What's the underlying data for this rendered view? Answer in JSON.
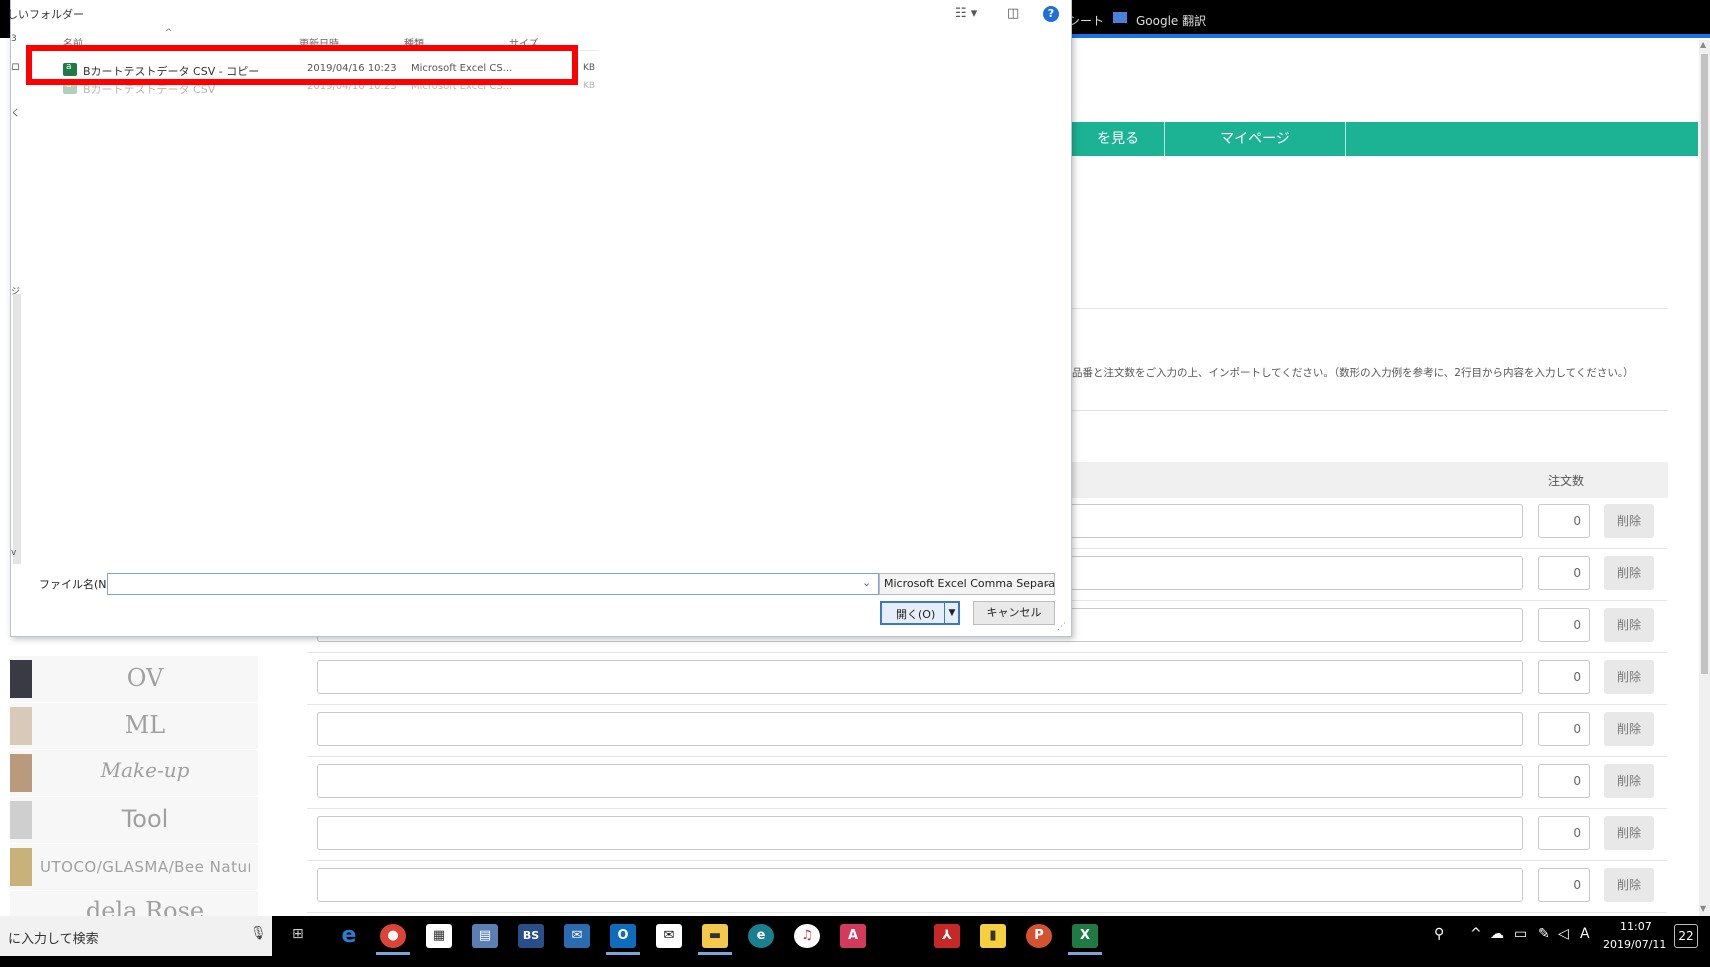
{
  "browser": {
    "bookmarks": [
      {
        "label": "シート"
      },
      {
        "label": "Google 翻訳"
      }
    ],
    "nav": [
      {
        "label": "を見る"
      },
      {
        "label": "マイページ"
      }
    ],
    "instruction": "品番と注文数をご入力の上、インポートしてください。（数形の入力例を参考に、2行目から内容を入力してください。）",
    "qty_header": "注文数",
    "rows": [
      {
        "qty": "0",
        "delete": "削除"
      },
      {
        "qty": "0",
        "delete": "削除"
      },
      {
        "qty": "0",
        "delete": "削除"
      },
      {
        "qty": "0",
        "delete": "削除"
      },
      {
        "qty": "0",
        "delete": "削除"
      },
      {
        "qty": "0",
        "delete": "削除"
      },
      {
        "qty": "0",
        "delete": "削除"
      },
      {
        "qty": "0",
        "delete": "削除"
      }
    ],
    "brands": [
      {
        "name": "OV"
      },
      {
        "name": "ML"
      },
      {
        "name": "Make-up"
      },
      {
        "name": "Tool"
      },
      {
        "name": "UTOCO/GLASMA/Bee Natural"
      },
      {
        "name": "dela Rose"
      }
    ]
  },
  "dialog": {
    "title": "しいフォルダー",
    "columns": {
      "name": "名前",
      "modified": "更新日時",
      "type": "種類",
      "size": "サイズ"
    },
    "files": [
      {
        "name": "Bカートテストデータ CSV - コピー",
        "modified": "2019/04/16 10:23",
        "type": "Microsoft Excel CS...",
        "size": "KB"
      },
      {
        "name": "Bカートテストデータ CSV",
        "modified": "2019/04/16 10:23",
        "type": "Microsoft Excel CS...",
        "size": "KB"
      }
    ],
    "filename_label": "ファイル名(N):",
    "filename_value": "",
    "filetype": "Microsoft Excel Comma Separat",
    "open_label": "開く(O)",
    "cancel_label": "キャンセル"
  },
  "taskbar": {
    "search_text": "に入力して検索",
    "tray_ime": "A",
    "time": "11:07",
    "date": "2019/07/11",
    "notifications": "22"
  }
}
